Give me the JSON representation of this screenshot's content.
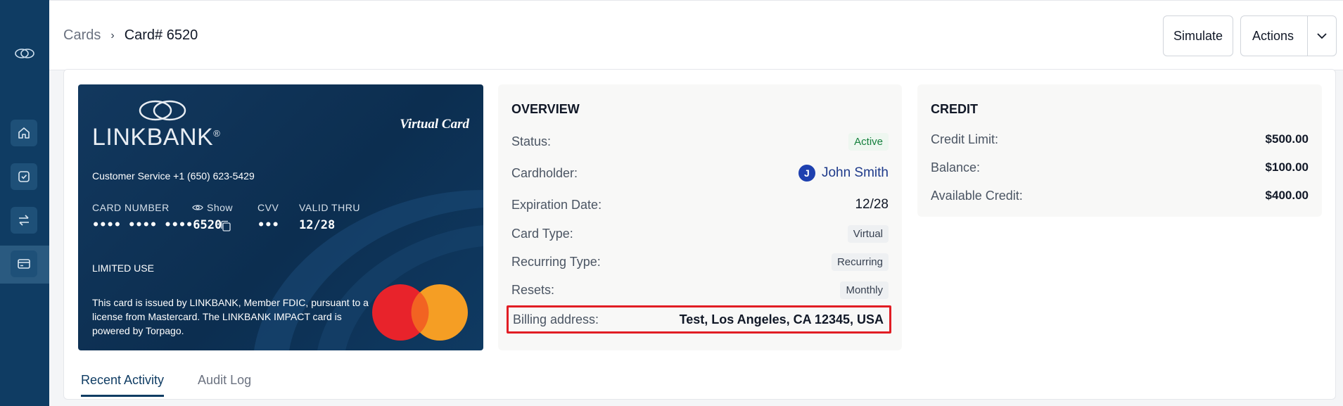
{
  "breadcrumb": {
    "parent": "Cards",
    "current": "Card# 6520"
  },
  "header_actions": {
    "simulate_label": "Simulate",
    "actions_label": "Actions"
  },
  "card": {
    "brand": "LINKBANK",
    "type_label": "Virtual Card",
    "customer_service": "Customer Service +1 (650) 623-5429",
    "number_label": "CARD NUMBER",
    "show_label": "Show",
    "number_masked": "•••• •••• ••••6520",
    "cvv_label": "CVV",
    "cvv_masked": "•••",
    "valid_label": "VALID THRU",
    "valid_value": "12/28",
    "limited_use": "LIMITED USE",
    "legal": "This card is issued by LINKBANK, Member FDIC, pursuant to a license from Mastercard. The LINKBANK IMPACT card is powered by Torpago."
  },
  "overview": {
    "title": "OVERVIEW",
    "status_label": "Status:",
    "status_value": "Active",
    "cardholder_label": "Cardholder:",
    "cardholder_initial": "J",
    "cardholder_name": "John Smith",
    "expiration_label": "Expiration Date:",
    "expiration_value": "12/28",
    "card_type_label": "Card Type:",
    "card_type_value": "Virtual",
    "recurring_label": "Recurring Type:",
    "recurring_value": "Recurring",
    "resets_label": "Resets:",
    "resets_value": "Monthly",
    "billing_label": "Billing address:",
    "billing_value": "Test, Los Angeles, CA 12345, USA"
  },
  "credit": {
    "title": "CREDIT",
    "limit_label": "Credit Limit:",
    "limit_value": "$500.00",
    "balance_label": "Balance:",
    "balance_value": "$100.00",
    "available_label": "Available Credit:",
    "available_value": "$400.00"
  },
  "tabs": [
    {
      "label": "Recent Activity",
      "active": true
    },
    {
      "label": "Audit Log",
      "active": false
    }
  ],
  "colors": {
    "sidebar": "#0f3c63",
    "highlight": "#e11d24",
    "active_green": "#15803d"
  }
}
